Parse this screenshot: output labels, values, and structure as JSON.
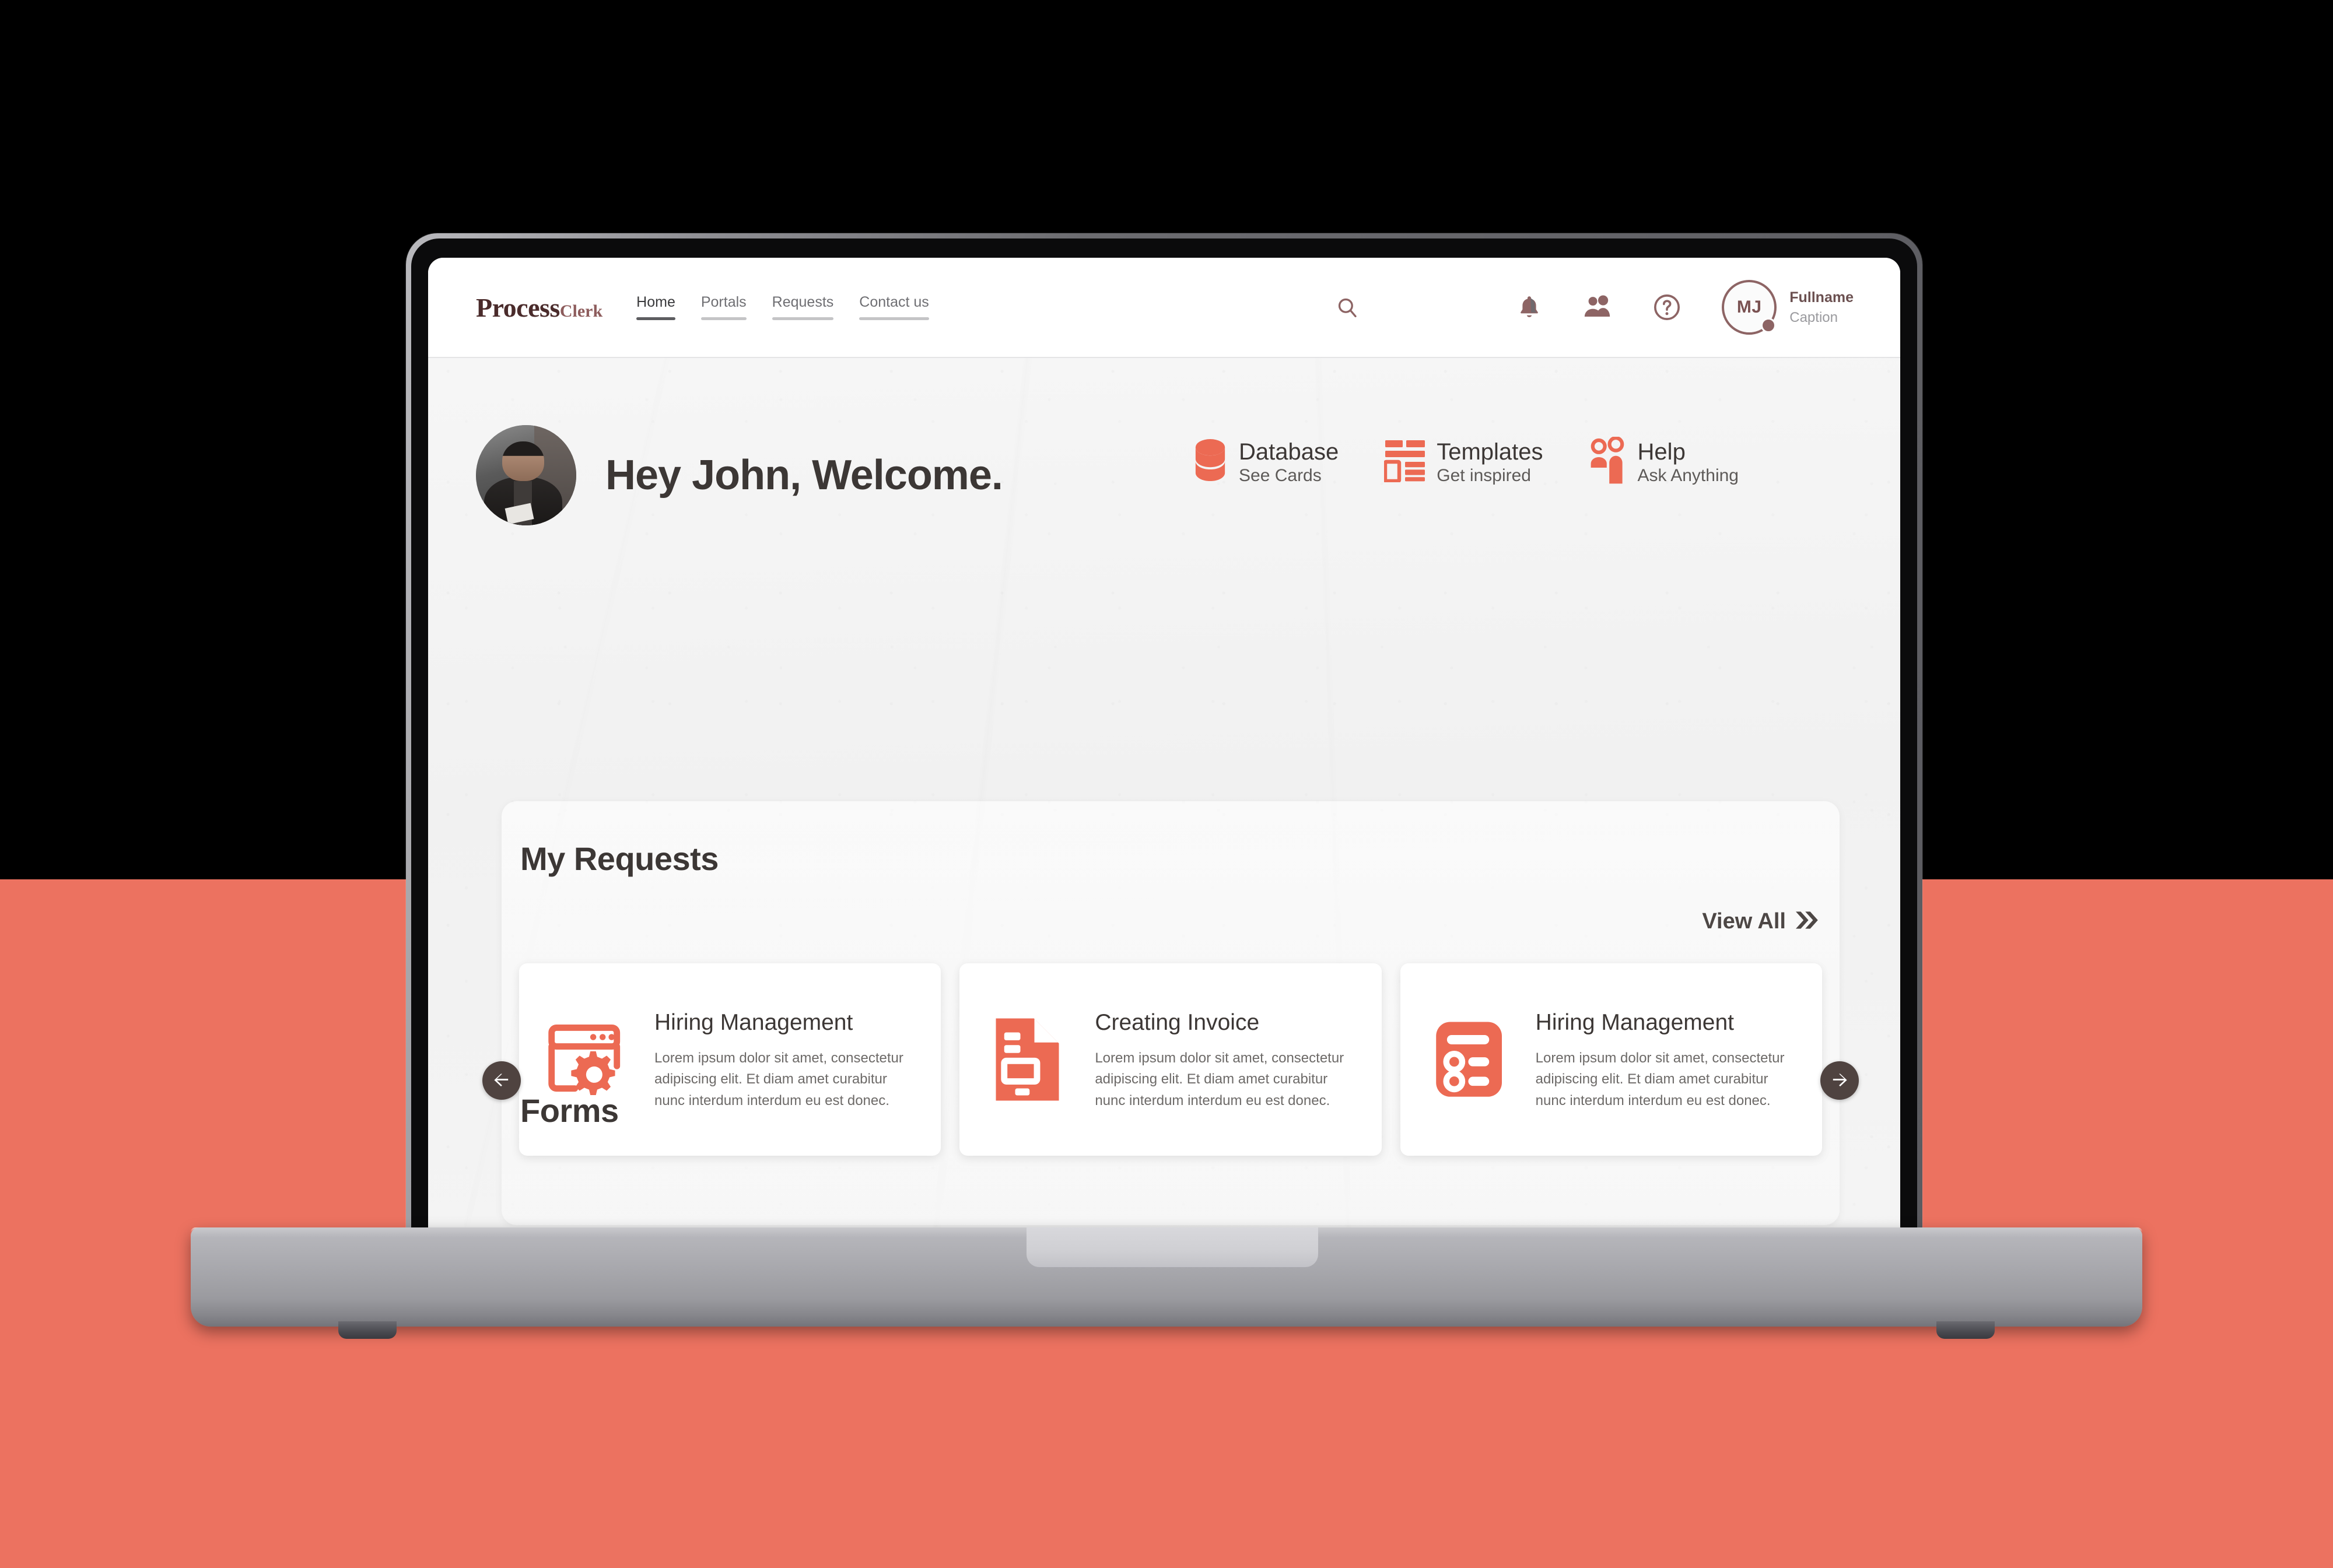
{
  "brand": {
    "logo_main": "Process",
    "logo_sub": "Clerk"
  },
  "nav": {
    "items": [
      {
        "label": "Home",
        "active": true
      },
      {
        "label": "Portals",
        "active": false
      },
      {
        "label": "Requests",
        "active": false
      },
      {
        "label": "Contact us",
        "active": false
      }
    ]
  },
  "header_icons": [
    {
      "name": "search-icon"
    },
    {
      "name": "notification-bell-icon"
    },
    {
      "name": "people-icon"
    },
    {
      "name": "help-icon"
    }
  ],
  "user": {
    "initials": "MJ",
    "name": "Fullname",
    "caption": "Caption"
  },
  "welcome": {
    "greeting": "Hey John, Welcome.",
    "avatar_alt": "profile-photo"
  },
  "quick_actions": [
    {
      "title": "Database",
      "subtitle": "See Cards",
      "icon": "database-icon"
    },
    {
      "title": "Templates",
      "subtitle": "Get inspired",
      "icon": "templates-icon"
    },
    {
      "title": "Help",
      "subtitle": "Ask Anything",
      "icon": "help-people-icon"
    }
  ],
  "requests": {
    "section_title": "My Requests",
    "view_all_label": "View All",
    "prev_label": "Previous",
    "next_label": "Next",
    "cards": [
      {
        "title": "Hiring Management",
        "description": "Lorem ipsum dolor sit amet, consectetur adipiscing elit. Et diam amet curabitur nunc interdum interdum eu est donec.",
        "icon": "browser-gear-icon"
      },
      {
        "title": "Creating Invoice",
        "description": "Lorem ipsum dolor sit amet, consectetur adipiscing elit. Et diam amet curabitur nunc interdum interdum eu est donec.",
        "icon": "invoice-document-icon"
      },
      {
        "title": "Hiring Management",
        "description": "Lorem ipsum dolor sit amet, consectetur adipiscing elit. Et diam amet curabitur nunc interdum interdum eu est donec.",
        "icon": "checklist-icon"
      }
    ]
  },
  "forms": {
    "section_title": "Forms"
  },
  "colors": {
    "accent": "#ec7260",
    "backdrop_top": "#000000",
    "backdrop_bottom": "#ec7260",
    "text_dark": "#3c3735",
    "brand_dark": "#4a2b2b",
    "brand_light": "#8d5c5c",
    "carousel_button": "#4f4340"
  }
}
